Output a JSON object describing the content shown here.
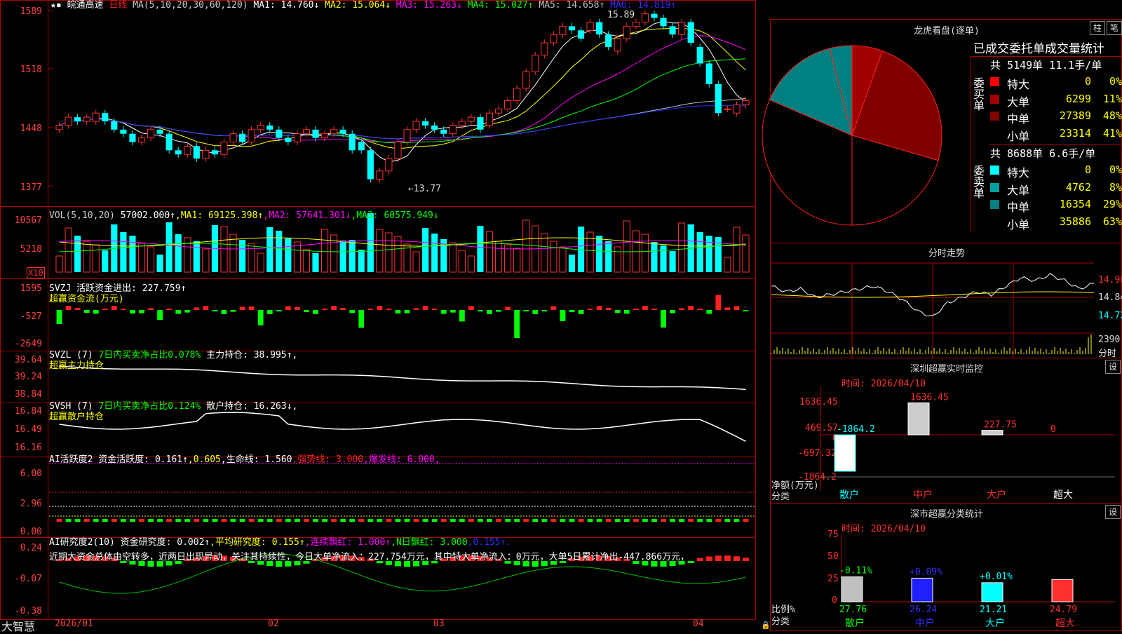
{
  "header": {
    "stock_name": "皖通高速",
    "period": "日线",
    "ma_label": "MA(5,10,20,30,60,120)",
    "ma_values": [
      {
        "label": "MA1: 14.760↓",
        "color": "#ffffff"
      },
      {
        "label": "MA2: 15.064↓",
        "color": "#ffff00"
      },
      {
        "label": "MA3: 15.263↓",
        "color": "#ff00ff"
      },
      {
        "label": "MA4: 15.027↑",
        "color": "#00ff00"
      },
      {
        "label": "MA5: 14.658↑",
        "color": "#c0c0c0"
      },
      {
        "label": "MA6: 14.819↑",
        "color": "#3030ff"
      }
    ],
    "high_note": "15.89",
    "low_note": "←13.77"
  },
  "price_axis": [
    "1589",
    "1518",
    "1448",
    "1377"
  ],
  "vol": {
    "legend": [
      {
        "t": "VOL(5,10,20)",
        "c": "#cccccc"
      },
      {
        "t": " 57002.000↑",
        "c": "#ffffff"
      },
      {
        "t": ",MA1: 69125.398↑",
        "c": "#ffff00"
      },
      {
        "t": ",MA2: 57641.301↓",
        "c": "#ff00ff"
      },
      {
        "t": ",MA3: 60575.949↓",
        "c": "#00ff00"
      }
    ],
    "axis": [
      "10567",
      "5218"
    ],
    "unit": "X10"
  },
  "svzj": {
    "legend": [
      {
        "t": "SVZJ  活跃资金进出: 227.759↑",
        "c": "#ffffff"
      }
    ],
    "sub": "超赢资金流(万元)",
    "axis": [
      "1595",
      "-527",
      "-2649"
    ]
  },
  "svzl": {
    "legend": [
      {
        "t": "SVZL (7) ",
        "c": "#ffffff"
      },
      {
        "t": "7日内买卖净占比0.078% ",
        "c": "#00ff00"
      },
      {
        "t": "主力持仓: 38.995↑,",
        "c": "#ffffff"
      }
    ],
    "sub": "超赢主力持仓",
    "axis": [
      "39.64",
      "39.24",
      "38.84"
    ]
  },
  "svsh": {
    "legend": [
      {
        "t": "SVSH (7) ",
        "c": "#ffffff"
      },
      {
        "t": "7日内买卖净占比0.124% ",
        "c": "#00ff00"
      },
      {
        "t": "散户持仓: 16.263↓,",
        "c": "#ffffff"
      }
    ],
    "sub": "超赢散户持仓",
    "axis": [
      "16.84",
      "16.49",
      "16.16"
    ]
  },
  "ai1": {
    "legend": [
      {
        "t": "AI活跃度2 资金活跃度: 0.161↑",
        "c": "#ffffff"
      },
      {
        "t": ",0.605",
        "c": "#ffff00"
      },
      {
        "t": ",生命线: 1.560",
        "c": "#ffffff"
      },
      {
        "t": ",强势线: 3.000",
        "c": "#ff2020"
      },
      {
        "t": ",爆发线: 6.000,",
        "c": "#ff00ff"
      }
    ],
    "axis": [
      "6.00",
      "2.96",
      "0.00"
    ]
  },
  "ai2": {
    "legend": [
      {
        "t": "AI研究度2(10) 资金研究度: 0.002↑",
        "c": "#ffffff"
      },
      {
        "t": ",平均研究度: 0.155↑",
        "c": "#ffff00"
      },
      {
        "t": ",连续飘红: 1.000↑",
        "c": "#ff00ff"
      },
      {
        "t": ",N日飘红: 3.000",
        "c": "#00ff00"
      },
      {
        "t": ",0.155↑.",
        "c": "#3030ff"
      }
    ],
    "comment": "近期大资金总体由空转多，近两日出现异动，关注其持续性，今日大单净流入：227.754万元，其中特大单净流入：0万元，大单5日累计净出-447.866万元，",
    "axis": [
      "0.24",
      "-0.07",
      "-0.38"
    ]
  },
  "date_axis": [
    "2026/01",
    "02",
    "03",
    "04"
  ],
  "brand": "大智慧",
  "lhb": {
    "title": "龙虎看盘(逐单)",
    "tab_zhu": "柱",
    "tab_bi": "笔",
    "stats_title": "已成交委托单成交量统计",
    "buy_side": "委买单",
    "sell_side": "委卖单",
    "buy_total": "共 5149单 11.1手/单",
    "sell_total": "共 8688单 6.6手/单",
    "buy_rows": [
      {
        "label": "特大",
        "val": "0",
        "pct": "0%",
        "color": "#ff0000"
      },
      {
        "label": "大单",
        "val": "6299",
        "pct": "11%",
        "color": "#a00000"
      },
      {
        "label": "中单",
        "val": "27389",
        "pct": "48%",
        "color": "#800000"
      },
      {
        "label": "小单",
        "val": "23314",
        "pct": "41%",
        "color": "#000000"
      }
    ],
    "sell_rows": [
      {
        "label": "特大",
        "val": "0",
        "pct": "0%",
        "color": "#00ffff"
      },
      {
        "label": "大单",
        "val": "4762",
        "pct": "8%",
        "color": "#00a0a0"
      },
      {
        "label": "中单",
        "val": "16354",
        "pct": "29%",
        "color": "#008080"
      },
      {
        "label": "小单",
        "val": "35886",
        "pct": "63%",
        "color": "#000000"
      }
    ]
  },
  "fenshi": {
    "title": "分时走势",
    "axis": [
      "14.90",
      "14.84",
      "14.72"
    ],
    "vol_max": "2390",
    "vol_unit": "分时"
  },
  "sz_monitor": {
    "title": "深圳超赢实时监控",
    "settings": "设",
    "time": "时间: 2026/04/10",
    "axis": [
      "1636.45",
      "469.57",
      "0",
      "-697.32",
      "-1864.2"
    ],
    "unit_label": "净额(万元)",
    "class_label": "分类",
    "categories": [
      "散户",
      "中户",
      "大户",
      "超大"
    ],
    "values": [
      -1864.2,
      1636.45,
      227.75,
      0
    ],
    "value_labels": [
      "-1864.2",
      "1636.45",
      "227.75",
      "0"
    ]
  },
  "sz_class": {
    "title": "深市超赢分类统计",
    "settings": "设",
    "time": "时间: 2026/04/10",
    "axis": [
      "75",
      "50",
      "25",
      "0"
    ],
    "ratio_label": "比例%",
    "class_label": "分类",
    "categories": [
      "散户",
      "中户",
      "大户",
      "超大"
    ],
    "change": [
      "-0.11%",
      "+0.09%",
      "+0.01%",
      ""
    ],
    "values": [
      27.76,
      26.24,
      21.21,
      24.79
    ],
    "value_labels": [
      "27.76",
      "26.24",
      "21.21",
      "24.79"
    ]
  },
  "chart_data": {
    "type": "bar",
    "title": "皖通高速 日线",
    "candles": {
      "open": [
        14.45,
        14.5,
        14.6,
        14.55,
        14.55,
        14.65,
        14.55,
        14.45,
        14.4,
        14.3,
        14.35,
        14.45,
        14.4,
        14.2,
        14.15,
        14.25,
        14.1,
        14.2,
        14.15,
        14.3,
        14.4,
        14.3,
        14.45,
        14.5,
        14.45,
        14.35,
        14.3,
        14.4,
        14.45,
        14.35,
        14.4,
        14.45,
        14.4,
        14.3,
        14.2,
        13.85,
        13.95,
        14.1,
        14.3,
        14.45,
        14.55,
        14.5,
        14.45,
        14.4,
        14.5,
        14.55,
        14.6,
        14.5,
        14.65,
        14.7,
        14.8,
        14.95,
        15.15,
        15.35,
        15.5,
        15.6,
        15.7,
        15.65,
        15.65,
        15.75,
        15.6,
        15.4,
        15.55,
        15.7,
        15.75,
        15.85,
        15.8,
        15.7,
        15.6,
        15.75,
        15.45,
        15.25,
        15.0,
        14.7,
        14.65,
        14.75
      ],
      "close": [
        14.5,
        14.6,
        14.55,
        14.6,
        14.65,
        14.55,
        14.45,
        14.4,
        14.3,
        14.35,
        14.45,
        14.4,
        14.2,
        14.15,
        14.25,
        14.1,
        14.2,
        14.15,
        14.3,
        14.4,
        14.3,
        14.45,
        14.5,
        14.45,
        14.35,
        14.3,
        14.4,
        14.45,
        14.35,
        14.4,
        14.45,
        14.4,
        14.2,
        14.2,
        13.85,
        13.95,
        14.1,
        14.3,
        14.45,
        14.55,
        14.5,
        14.45,
        14.4,
        14.5,
        14.55,
        14.6,
        14.45,
        14.65,
        14.7,
        14.8,
        14.95,
        15.15,
        15.35,
        15.5,
        15.6,
        15.7,
        15.65,
        15.55,
        15.75,
        15.6,
        15.45,
        15.55,
        15.7,
        15.75,
        15.85,
        15.8,
        15.7,
        15.6,
        15.75,
        15.5,
        15.25,
        15.0,
        14.65,
        14.7,
        14.75,
        14.8
      ]
    },
    "fenshi_price": [
      14.84,
      14.82,
      14.83,
      14.8,
      14.81,
      14.82,
      14.83,
      14.84,
      14.82,
      14.79,
      14.75,
      14.73,
      14.78,
      14.8,
      14.82,
      14.81,
      14.84,
      14.87,
      14.86,
      14.88,
      14.86,
      14.83,
      14.85
    ]
  }
}
